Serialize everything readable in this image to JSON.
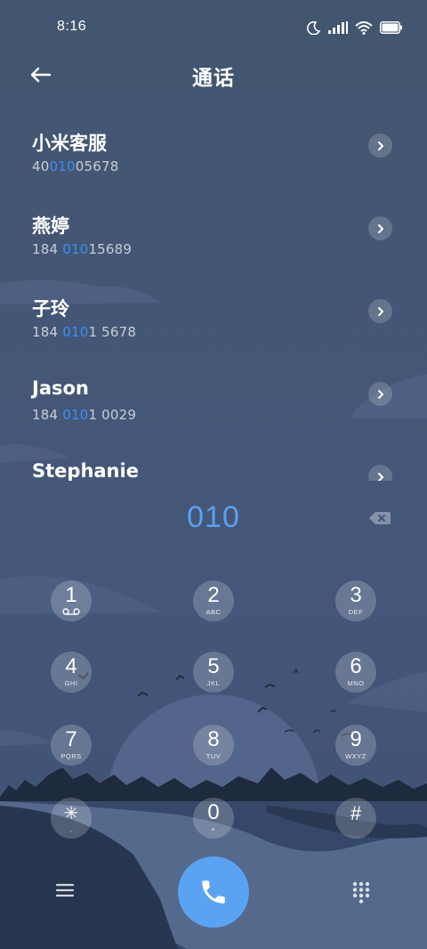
{
  "status_bar": {
    "time": "8:16",
    "icons": [
      "moon-icon",
      "signal-icon",
      "wifi-icon",
      "battery-icon"
    ]
  },
  "header": {
    "title": "通话",
    "back_icon": "back-arrow-icon"
  },
  "contacts": [
    {
      "name": "小米客服",
      "number_pre": "40",
      "number_match": "010",
      "number_post": "05678"
    },
    {
      "name": "燕婷",
      "number_pre": "184 ",
      "number_match": "010",
      "number_post": "15689"
    },
    {
      "name": "子玲",
      "number_pre": "184 ",
      "number_match": "010",
      "number_post": "1 5678"
    },
    {
      "name": "Jason",
      "number_pre": "184 ",
      "number_match": "010",
      "number_post": "1 0029"
    },
    {
      "name": "Stephanie",
      "number_pre": "",
      "number_match": "",
      "number_post": ""
    }
  ],
  "dialer": {
    "input": "010",
    "backspace_icon": "backspace-icon"
  },
  "keypad": [
    {
      "digit": "1",
      "letters": ""
    },
    {
      "digit": "2",
      "letters": "ABC"
    },
    {
      "digit": "3",
      "letters": "DEF"
    },
    {
      "digit": "4",
      "letters": "GHI"
    },
    {
      "digit": "5",
      "letters": "JKL"
    },
    {
      "digit": "6",
      "letters": "MNO"
    },
    {
      "digit": "7",
      "letters": "PQRS"
    },
    {
      "digit": "8",
      "letters": "TUV"
    },
    {
      "digit": "9",
      "letters": "WXYZ"
    },
    {
      "digit": "✳",
      "letters": ","
    },
    {
      "digit": "0",
      "letters": "+"
    },
    {
      "digit": "#",
      "letters": ""
    }
  ],
  "bottom_bar": {
    "menu_icon": "menu-icon",
    "call_icon": "phone-icon",
    "keypad_icon": "dialpad-icon"
  },
  "colors": {
    "background": "#435674",
    "highlight": "#3c8ff0",
    "dial_text": "#5ba0ee",
    "call_button": "#5aa3f3"
  }
}
